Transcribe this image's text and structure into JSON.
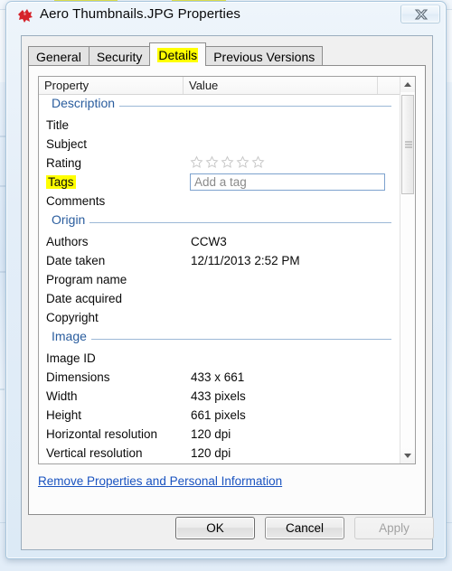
{
  "window": {
    "title": "Aero Thumbnails.JPG Properties",
    "icon": "image-file-icon",
    "close_label": "Close"
  },
  "tabs": [
    {
      "label": "General",
      "selected": false
    },
    {
      "label": "Security",
      "selected": false
    },
    {
      "label": "Details",
      "selected": true
    },
    {
      "label": "Previous Versions",
      "selected": false
    }
  ],
  "list": {
    "columns": [
      "Property",
      "Value",
      ""
    ],
    "groups": [
      {
        "name": "Description",
        "rows": [
          {
            "name": "Title",
            "value": ""
          },
          {
            "name": "Subject",
            "value": ""
          },
          {
            "name": "Rating",
            "value": "",
            "control": "stars",
            "stars_total": 5,
            "stars_filled": 0
          },
          {
            "name": "Tags",
            "value": "",
            "control": "tag-input",
            "placeholder": "Add a tag",
            "highlight": true
          },
          {
            "name": "Comments",
            "value": ""
          }
        ]
      },
      {
        "name": "Origin",
        "rows": [
          {
            "name": "Authors",
            "value": "CCW3"
          },
          {
            "name": "Date taken",
            "value": "12/11/2013 2:52 PM"
          },
          {
            "name": "Program name",
            "value": ""
          },
          {
            "name": "Date acquired",
            "value": ""
          },
          {
            "name": "Copyright",
            "value": ""
          }
        ]
      },
      {
        "name": "Image",
        "rows": [
          {
            "name": "Image ID",
            "value": ""
          },
          {
            "name": "Dimensions",
            "value": "433 x 661"
          },
          {
            "name": "Width",
            "value": "433 pixels"
          },
          {
            "name": "Height",
            "value": "661 pixels"
          },
          {
            "name": "Horizontal resolution",
            "value": "120 dpi"
          },
          {
            "name": "Vertical resolution",
            "value": "120 dpi"
          }
        ]
      }
    ]
  },
  "link": {
    "label": "Remove Properties and Personal Information"
  },
  "buttons": {
    "ok": "OK",
    "cancel": "Cancel",
    "apply": "Apply"
  },
  "colors": {
    "highlight": "#ffff00",
    "group_heading": "#2a5d9e",
    "link": "#1a53c0",
    "tag_border": "#7da2ce"
  }
}
